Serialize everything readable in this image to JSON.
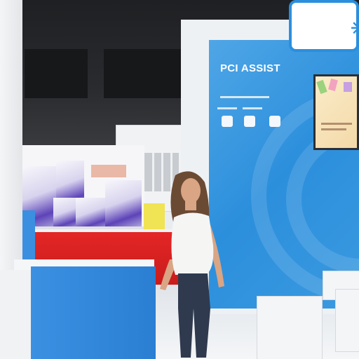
{
  "booth": {
    "wall_title": "PCI ASSIST",
    "accent_blue": "#2c8fdc",
    "counter_red": "#d42121"
  },
  "scene": {
    "icons": [
      "wall-icon-1",
      "wall-icon-2",
      "wall-icon-3",
      "logo-icon"
    ]
  }
}
